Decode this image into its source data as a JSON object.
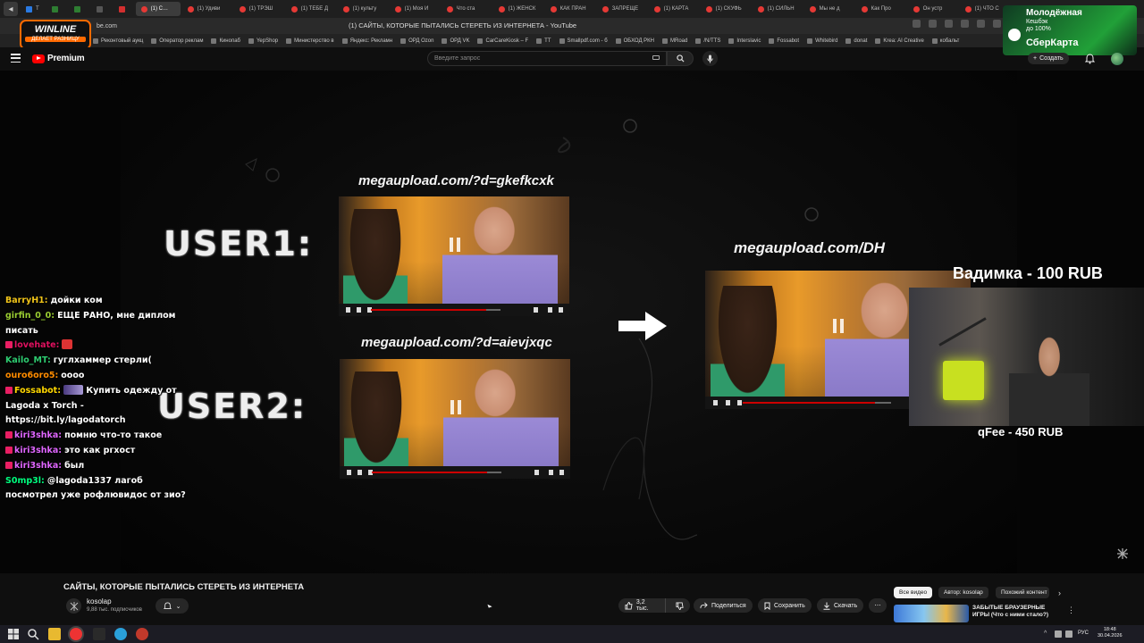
{
  "browser": {
    "tabs": [
      {
        "label": "Т",
        "pinned": true
      },
      {
        "label": "",
        "pinned": true
      },
      {
        "label": "",
        "pinned": true
      },
      {
        "label": "",
        "pinned": true
      },
      {
        "label": "",
        "pinned": true
      },
      {
        "label": "(1) С…",
        "active": true
      },
      {
        "label": "(1) Удиви"
      },
      {
        "label": "(1) ТРЭШ"
      },
      {
        "label": "(1) ТЕБЕ Д"
      },
      {
        "label": "(1) культу"
      },
      {
        "label": "(1) Моя И"
      },
      {
        "label": "Что ста"
      },
      {
        "label": "(1) ЖЕНСК"
      },
      {
        "label": "КАК ПРАН"
      },
      {
        "label": "ЗАПРЕЩЕ"
      },
      {
        "label": "(1) КАРТА"
      },
      {
        "label": "(1) СКУФЬ"
      },
      {
        "label": "(1) СИЛЬН"
      },
      {
        "label": "Мы не д"
      },
      {
        "label": "Как Про"
      },
      {
        "label": "Он устр"
      },
      {
        "label": "(1) ЧТО С"
      }
    ],
    "url": "be.com",
    "page_title": "(1) САЙТЫ, КОТОРЫЕ ПЫТАЛИСЬ СТЕРЕТЬ ИЗ ИНТЕРНЕТА - YouTube",
    "bookmarks": [
      "Реконтовый аукц",
      "Оператор реклам",
      "Кинопаб",
      "YepShop",
      "Министерство в",
      "Яндекс: Рекламн",
      "ОРД Ozon",
      "ОРД VK",
      "CarCareKiosk – F",
      "TT",
      "Smallpdf.com - б",
      "ОБХОД РКН",
      "MRoad",
      "/N/TTS",
      "Interslavic",
      "Fossabot",
      "Whitebird",
      "donat",
      "Krea: AI Creative",
      "кобальт"
    ]
  },
  "ads": {
    "winline_title": "WINLINE",
    "winline_slogan": "ДЕЛАЕТ РАЗНИЦУ",
    "sber_title": "Молодёжная",
    "sber_line1": "Кешбэк",
    "sber_line2": "до 100%",
    "sber_brand": "СберКарта"
  },
  "youtube": {
    "logo_label": "Premium",
    "search_placeholder": "Введите запрос",
    "create_label": "Создать"
  },
  "video": {
    "user1": "USER1:",
    "user2": "USER2:",
    "url1": "megaupload.com/?d=gkefkcxk",
    "url2": "megaupload.com/?d=aievjxqc",
    "url3": "megaupload.com/DH",
    "donation1": "Вадимка - 100 RUB",
    "donation2": "qFee - 450 RUB"
  },
  "chat": [
    {
      "user": "BarryH1:",
      "color": "#f0c419",
      "text": "дойки ком"
    },
    {
      "user": "girfin_0_0:",
      "color": "#9acd32",
      "text": "ЕЩЕ РАНО, мне диплом писать"
    },
    {
      "user": "lovehate:",
      "color": "#e0115f",
      "text": "",
      "badge": true,
      "emote": "red"
    },
    {
      "user": "Kailo_MT:",
      "color": "#2ecc71",
      "text": "гуглхаммер стерли("
    },
    {
      "user": "ouro6oro5:",
      "color": "#ff8c00",
      "text": "оооо"
    },
    {
      "user": "Fossabot:",
      "color": "#ffd700",
      "text": "Купить одежду от Lagoda x Torch - https://bit.ly/lagodatorch",
      "badge": true,
      "emote": "purple"
    },
    {
      "user": "kiri3shka:",
      "color": "#e066ff",
      "text": "помню что-то такое",
      "badge": true
    },
    {
      "user": "kiri3shka:",
      "color": "#e066ff",
      "text": "это как ргхост",
      "badge": true
    },
    {
      "user": "kiri3shka:",
      "color": "#e066ff",
      "text": "был",
      "badge": true
    },
    {
      "user": "S0mp3l:",
      "color": "#00ff7f",
      "text": "@lagoda1337 лагоб посмотрел уже рофлювидос от зио?"
    }
  ],
  "below": {
    "title": "САЙТЫ, КОТОРЫЕ ПЫТАЛИСЬ СТЕРЕТЬ ИЗ ИНТЕРНЕТА",
    "channel": "kosolap",
    "subs": "9,88 тыс. подписчиков",
    "likes": "3,2 тыс.",
    "share": "Поделиться",
    "save": "Сохранить",
    "download": "Скачать",
    "chip_all": "Все видео",
    "chip_author": "Автор: kosolap",
    "chip_similar": "Похожий контент",
    "rec_title": "ЗАБЫТЫЕ БРАУЗЕРНЫЕ ИГРЫ (Что с ними стало?)"
  },
  "taskbar": {
    "lang": "РУС",
    "time": "18:48",
    "date": "30.04.2026"
  },
  "colors": {
    "accent_red": "#ff0000",
    "winline_orange": "#ff6a00",
    "sber_green": "#21a038"
  }
}
